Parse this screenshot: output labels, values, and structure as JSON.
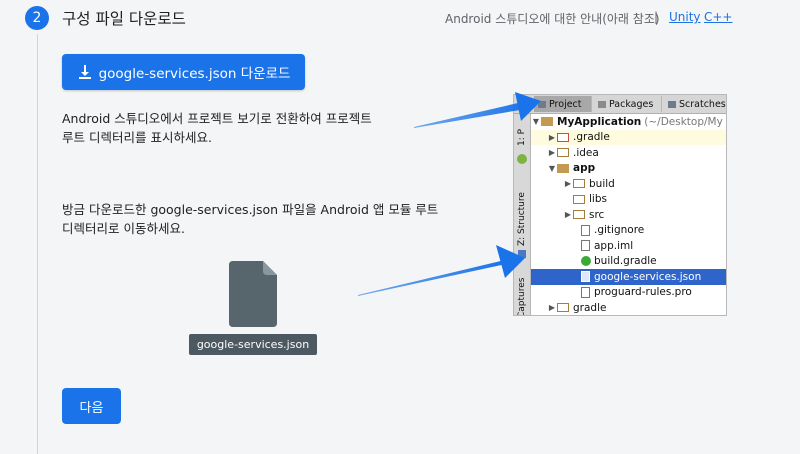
{
  "step": {
    "number": "2",
    "title": "구성 파일 다운로드",
    "guide_text": "Android 스튜디오에 대한 안내(아래 참조)",
    "separator": "|",
    "links": [
      "Unity",
      "C++"
    ]
  },
  "download_button": {
    "label": "google-services.json 다운로드",
    "icon": "download-icon"
  },
  "instruction1": {
    "line1": "Android 스튜디오에서 프로젝트 보기로 전환하여 프로젝트",
    "line2": "루트 디렉터리를 표시하세요."
  },
  "instruction2": {
    "line1": "방금 다운로드한 google-services.json 파일을 Android 앱 모듈 루트",
    "line2": "디렉터리로 이동하세요."
  },
  "file": {
    "label": "google-services.json",
    "icon": "file-icon"
  },
  "next_button": {
    "label": "다음"
  },
  "ide": {
    "tabs": [
      "Project",
      "Packages",
      "Scratches"
    ],
    "side_tabs": [
      "1: P",
      "Z: Structure",
      "Captures"
    ],
    "tree": [
      {
        "label": "MyApplication",
        "suffix": "(~/Desktop/My",
        "icon": "module-folder"
      },
      {
        "label": ".gradle",
        "icon": "folder-red"
      },
      {
        "label": ".idea",
        "icon": "folder"
      },
      {
        "label": "app",
        "icon": "module-folder"
      },
      {
        "label": "build",
        "icon": "folder"
      },
      {
        "label": "libs",
        "icon": "folder"
      },
      {
        "label": "src",
        "icon": "folder"
      },
      {
        "label": ".gitignore",
        "icon": "file"
      },
      {
        "label": "app.iml",
        "icon": "file"
      },
      {
        "label": "build.gradle",
        "icon": "gradle"
      },
      {
        "label": "google-services.json",
        "icon": "json-file"
      },
      {
        "label": "proguard-rules.pro",
        "icon": "file"
      },
      {
        "label": "gradle",
        "icon": "folder"
      }
    ]
  },
  "colors": {
    "primary": "#1a73e8",
    "selection": "#2f65ca",
    "arrow": "#1a73e8"
  }
}
